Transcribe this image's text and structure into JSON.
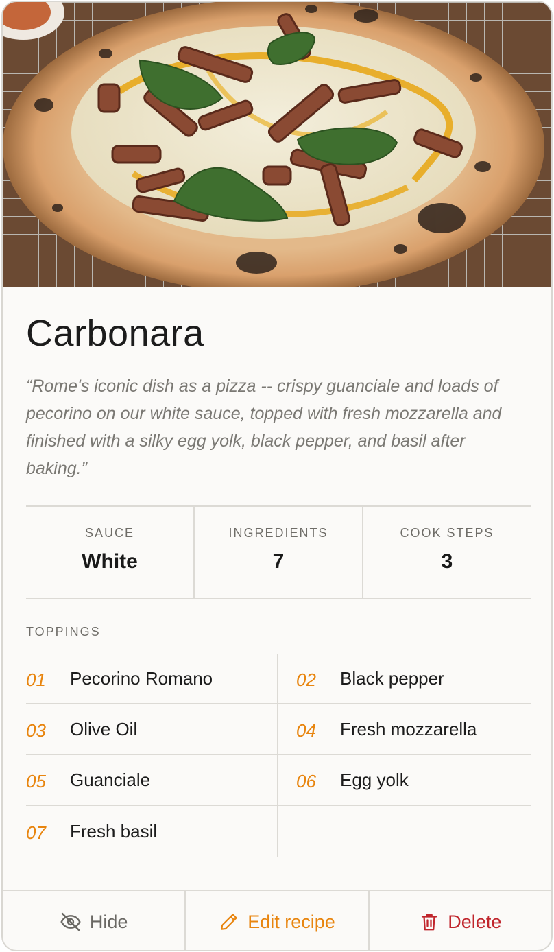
{
  "recipe": {
    "title": "Carbonara",
    "description": "“Rome's iconic dish as a pizza -- crispy guanciale and loads of pecorino on our white sauce, topped with fresh mozzarella and finished with a silky egg yolk, black pepper, and basil after baking.”",
    "photo_alt": "carbonara-pizza-photo"
  },
  "stats": [
    {
      "label": "SAUCE",
      "value": "White"
    },
    {
      "label": "INGREDIENTS",
      "value": "7"
    },
    {
      "label": "COOK STEPS",
      "value": "3"
    }
  ],
  "toppings": {
    "label": "TOPPINGS",
    "items": [
      {
        "num": "01",
        "name": "Pecorino Romano"
      },
      {
        "num": "02",
        "name": "Black pepper"
      },
      {
        "num": "03",
        "name": "Olive Oil"
      },
      {
        "num": "04",
        "name": "Fresh mozzarella"
      },
      {
        "num": "05",
        "name": "Guanciale"
      },
      {
        "num": "06",
        "name": "Egg yolk"
      },
      {
        "num": "07",
        "name": "Fresh basil"
      }
    ]
  },
  "actions": {
    "hide_label": "Hide",
    "hide_icon": "eye-off-icon",
    "edit_label": "Edit recipe",
    "edit_icon": "pencil-icon",
    "delete_label": "Delete",
    "delete_icon": "trash-icon"
  },
  "colors": {
    "accent": "#e8850f",
    "danger": "#c0262d",
    "muted": "#7a7873",
    "card_bg": "#fbfaf8",
    "border": "#dcdad5"
  }
}
